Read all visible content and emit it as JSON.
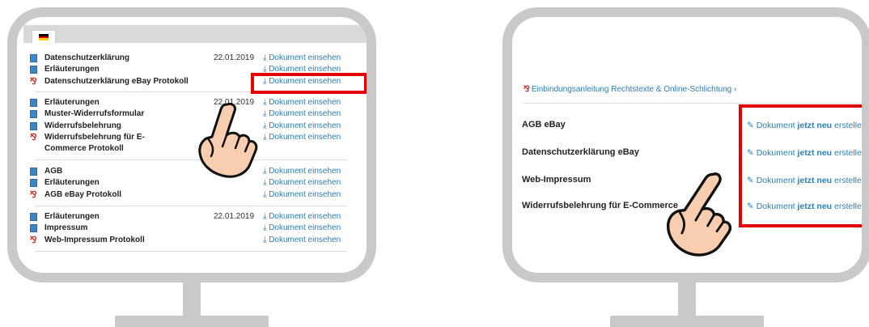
{
  "left_screen": {
    "groups": [
      {
        "rows": [
          {
            "name": "Datenschutzerklärung",
            "date": "22.01.2019",
            "link": "⤓ Dokument einsehen",
            "icon": "doc-icon"
          },
          {
            "name": "Erläuterungen",
            "date": "",
            "link": "⤓ Dokument einsehen",
            "icon": "doc-icon"
          },
          {
            "name": "Datenschutzerklärung eBay Protokoll",
            "date": "",
            "link": "⤓ Dokument einsehen",
            "icon": "pdf-icon"
          }
        ]
      },
      {
        "rows": [
          {
            "name": "Erläuterungen",
            "date": "22.01.2019",
            "link": "⤓ Dokument einsehen",
            "icon": "doc-icon"
          },
          {
            "name": "Muster-Widerrufsformular",
            "date": "",
            "link": "⤓ Dokument einsehen",
            "icon": "doc-icon"
          },
          {
            "name": "Widerrufsbelehrung",
            "date": "",
            "link": "⤓ Dokument einsehen",
            "icon": "doc-icon"
          },
          {
            "name": "Widerrufsbelehrung für E-",
            "date": "",
            "link": "⤓ Dokument einsehen",
            "icon": "pdf-icon"
          },
          {
            "name": "Commerce Protokoll",
            "date": "",
            "link": "",
            "icon": ""
          }
        ]
      },
      {
        "rows": [
          {
            "name": "AGB",
            "date": "",
            "link": "⤓ Dokument einsehen",
            "icon": "doc-icon"
          },
          {
            "name": "Erläuterungen",
            "date": "",
            "link": "⤓ Dokument einsehen",
            "icon": "doc-icon"
          },
          {
            "name": "AGB eBay Protokoll",
            "date": "",
            "link": "⤓ Dokument einsehen",
            "icon": "pdf-icon"
          }
        ]
      },
      {
        "rows": [
          {
            "name": "Erläuterungen",
            "date": "22.01.2019",
            "link": "⤓ Dokument einsehen",
            "icon": "doc-icon"
          },
          {
            "name": "Impressum",
            "date": "",
            "link": "⤓ Dokument einsehen",
            "icon": "doc-icon"
          },
          {
            "name": "Web-Impressum Protokoll",
            "date": "",
            "link": "⤓ Dokument einsehen",
            "icon": "pdf-icon"
          }
        ]
      }
    ]
  },
  "right_screen": {
    "header_link": "Einbindungsanleitung Rechtstexte & Online-Schlichtung ›",
    "rows": [
      {
        "name": "AGB eBay",
        "link_pre": "Dokument ",
        "link_bold": "jetzt neu",
        "link_post": " erstellen"
      },
      {
        "name": "Datenschutzerklärung eBay",
        "link_pre": "Dokument ",
        "link_bold": "jetzt neu",
        "link_post": " erstellen"
      },
      {
        "name": "Web-Impressum",
        "link_pre": "Dokument ",
        "link_bold": "jetzt neu",
        "link_post": " erstellen"
      },
      {
        "name": "Widerrufsbelehrung für E-Commerce",
        "link_pre": "Dokument ",
        "link_bold": "jetzt neu",
        "link_post": " erstellen"
      }
    ]
  },
  "colors": {
    "highlight": "#e30000",
    "link": "#2b7fb8",
    "frame": "#c9c9c9"
  },
  "icons": [
    "german-flag-icon",
    "doc-icon",
    "pdf-icon",
    "download-icon",
    "pointing-hand-icon",
    "edit-document-icon"
  ]
}
